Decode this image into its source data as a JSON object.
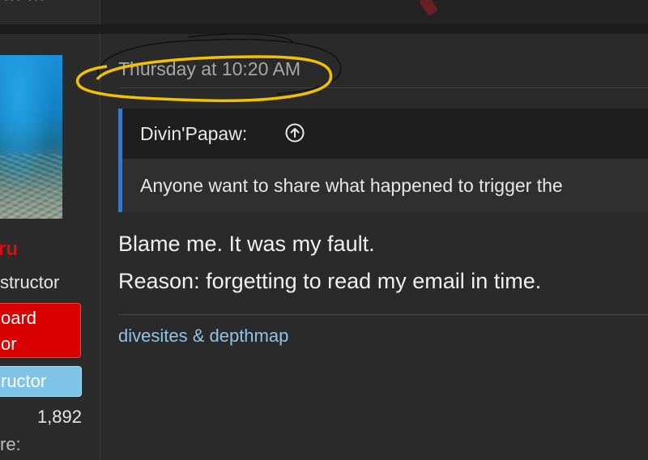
{
  "top": {
    "previous_post_fragment": "··· ···"
  },
  "sidebar": {
    "username": "ru",
    "user_title": "structor",
    "badge_primary": [
      "oard",
      "or"
    ],
    "badge_secondary": "ructor",
    "stat_value": "1,892",
    "stat_label": "re:"
  },
  "post": {
    "timestamp": "Thursday at 10:20 AM",
    "quote": {
      "author": "Divin'Papaw:",
      "author_icon": "arrow-up-circle-icon",
      "text": "Anyone want to share what happened to trigger the"
    },
    "message": [
      "Blame me. It was my fault.",
      "Reason: forgetting to read my email in time."
    ],
    "tags": "divesites & depthmap"
  },
  "colors": {
    "background": "#2a2a2a",
    "username_red": "#d11111",
    "badge_red": "#d80000",
    "badge_blue": "#7ec4e6",
    "quote_border": "#3b78c4",
    "link": "#8fc4ea",
    "annotation_yellow": "#f2c200",
    "annotation_black": "#111111"
  }
}
